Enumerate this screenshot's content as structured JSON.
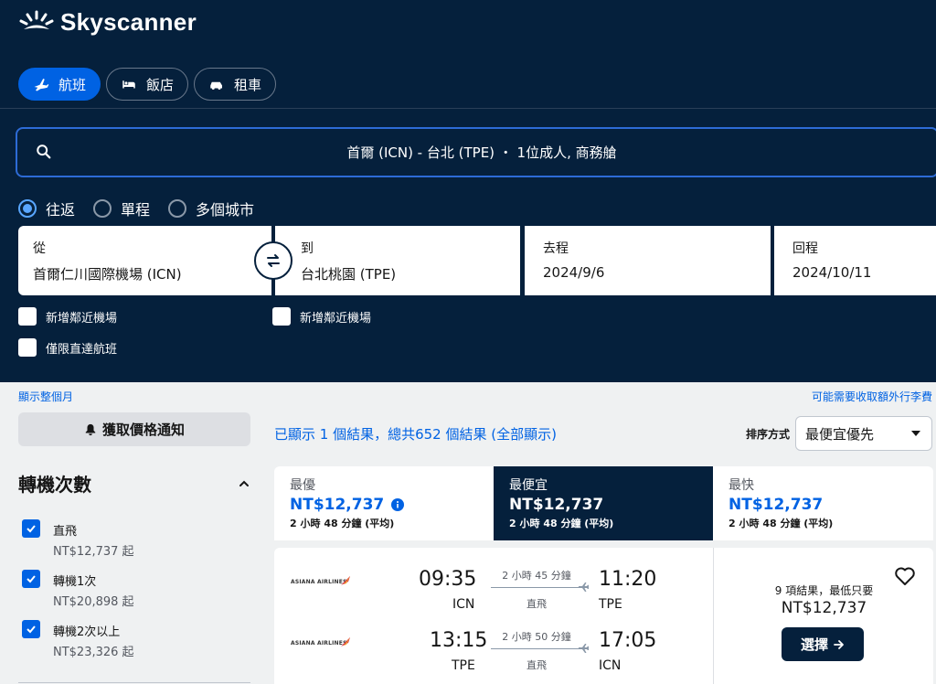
{
  "brand": {
    "name": "Skyscanner"
  },
  "nav_tabs": [
    {
      "label": "航班",
      "icon": "plane-icon",
      "active": true
    },
    {
      "label": "飯店",
      "icon": "bed-icon",
      "active": false
    },
    {
      "label": "租車",
      "icon": "car-icon",
      "active": false
    }
  ],
  "search_summary": "首爾 (ICN) - 台北 (TPE) ・ 1位成人, 商務艙",
  "trip_types": [
    {
      "label": "往返",
      "selected": true
    },
    {
      "label": "單程",
      "selected": false
    },
    {
      "label": "多個城市",
      "selected": false
    }
  ],
  "fields": {
    "from": {
      "label": "從",
      "value": "首爾仁川國際機場 (ICN)"
    },
    "to": {
      "label": "到",
      "value": "台北桃園 (TPE)"
    },
    "depart": {
      "label": "去程",
      "value": "2024/9/6"
    },
    "return": {
      "label": "回程",
      "value": "2024/10/11"
    }
  },
  "checkboxes": {
    "nearby_from": "新增鄰近機場",
    "nearby_to": "新增鄰近機場",
    "direct_only": "僅限直達航班"
  },
  "links": {
    "show_month": "顯示整個月",
    "bag_fees": "可能需要收取額外行李費"
  },
  "price_alert": "獲取價格通知",
  "filters": {
    "stops_title": "轉機次數",
    "items": [
      {
        "label": "直飛",
        "price": "NT$12,737 起",
        "checked": true
      },
      {
        "label": "轉機1次",
        "price": "NT$20,898 起",
        "checked": true
      },
      {
        "label": "轉機2次以上",
        "price": "NT$23,326 起",
        "checked": true
      }
    ]
  },
  "results": {
    "count_text": "已顯示 1 個結果，總共652 個結果 (全部顯示)",
    "sort_label": "排序方式",
    "sort_value": "最便宜優先"
  },
  "sort_tabs": [
    {
      "title": "最優",
      "price": "NT$12,737",
      "duration": "2 小時 48 分鐘 (平均)",
      "active": false
    },
    {
      "title": "最便宜",
      "price": "NT$12,737",
      "duration": "2 小時 48 分鐘 (平均)",
      "active": true
    },
    {
      "title": "最快",
      "price": "NT$12,737",
      "duration": "2 小時 48 分鐘 (平均)",
      "active": false
    }
  ],
  "itinerary": {
    "airline": "ASIANA AIRLINES",
    "outbound": {
      "depart_time": "09:35",
      "depart_code": "ICN",
      "duration": "2 小時 45 分鐘",
      "stops": "直飛",
      "arrive_time": "11:20",
      "arrive_code": "TPE"
    },
    "inbound": {
      "depart_time": "13:15",
      "depart_code": "TPE",
      "duration": "2 小時 50 分鐘",
      "stops": "直飛",
      "arrive_time": "17:05",
      "arrive_code": "ICN"
    },
    "deals_text": "9 項結果，最低只要",
    "price": "NT$12,737",
    "select_label": "選擇"
  },
  "colors": {
    "navy": "#05203c",
    "blue": "#0062e3",
    "bg": "#eff1f2"
  }
}
